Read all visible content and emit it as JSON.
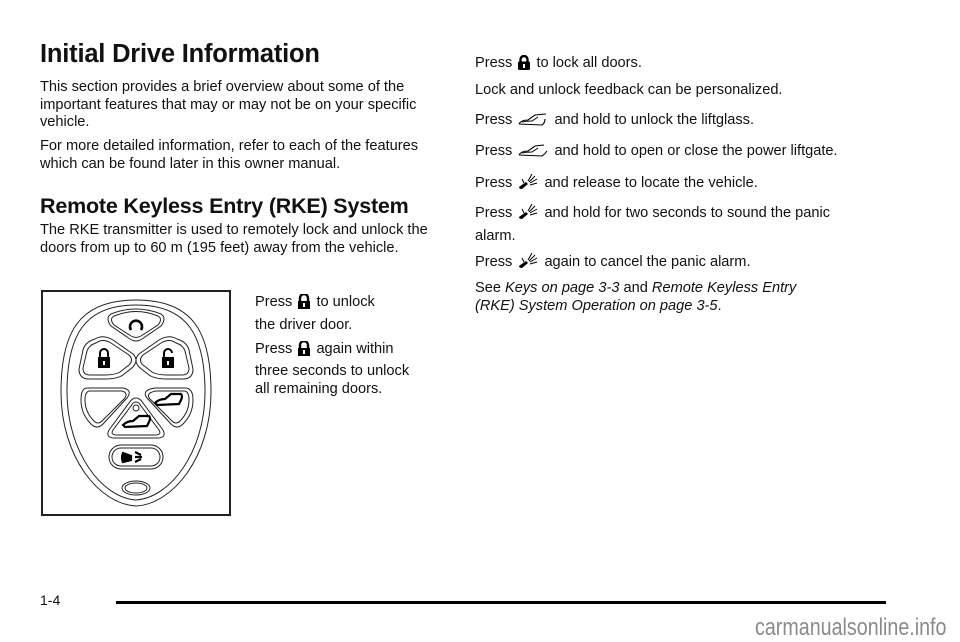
{
  "page": {
    "title": "Initial Drive Information",
    "intro_paragraphs": [
      "This section provides a brief overview about some of the important features that may or may not be on your specific vehicle.",
      "For more detailed information, refer to each of the features which can be found later in this owner manual."
    ],
    "section_heading": "Remote Keyless Entry (RKE) System",
    "section_paragraph": "The RKE transmitter is used to remotely lock and unlock the doors from up to 60 m (195 feet) away from the vehicle.",
    "figure": {
      "icon": "rke-transmitter-illustration",
      "buttons": [
        "remote-start",
        "lock",
        "unlock",
        "blank",
        "liftglass",
        "power-liftgate",
        "panic-alarm"
      ]
    },
    "unlock_instructions": {
      "line1_pre": "Press",
      "line1_post": "to unlock",
      "line2": "the driver door.",
      "line3_pre": "Press",
      "line3_post": "again within",
      "line4": "three seconds to unlock",
      "line5": "all remaining doors.",
      "icon": "unlock-icon"
    },
    "right_column": {
      "lock": {
        "pre": "Press",
        "post": "to lock all doors.",
        "icon": "lock-icon"
      },
      "feedback": "Lock and unlock feedback can be personalized.",
      "liftglass": {
        "pre": "Press",
        "post": "and hold to unlock the liftglass.",
        "icon": "liftglass-icon"
      },
      "liftgate": {
        "pre": "Press",
        "post": "and hold to open or close the power liftgate.",
        "icon": "liftgate-icon"
      },
      "locate": {
        "pre": "Press",
        "post": "and release to locate the vehicle.",
        "icon": "horn-icon"
      },
      "panic": {
        "pre": "Press",
        "post1": "and hold for two seconds to sound the panic",
        "post2": "alarm.",
        "icon": "horn-icon"
      },
      "cancel": {
        "pre": "Press",
        "post": "again to cancel the panic alarm.",
        "icon": "horn-icon"
      },
      "see_also": {
        "see": "See",
        "link1": "Keys on page 3-3",
        "and": "and",
        "link2a": "Remote Keyless Entry",
        "link2b": "(RKE) System Operation on page 3-5",
        "period": "."
      }
    },
    "footer": {
      "page_number": "1-4",
      "watermark": "carmanualsonline.info"
    }
  }
}
